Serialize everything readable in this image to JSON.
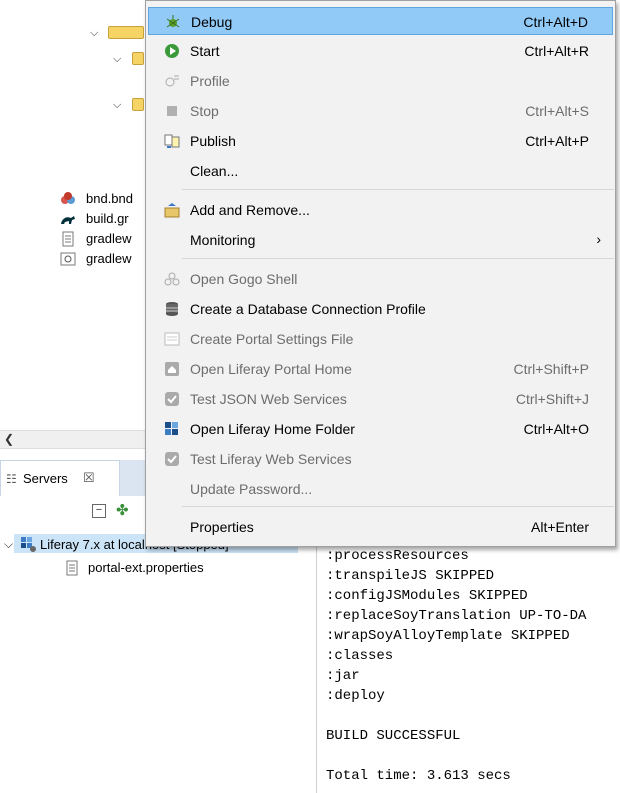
{
  "tree": {
    "files": [
      "bnd.bnd",
      "build.gr",
      "gradlew",
      "gradlew"
    ]
  },
  "servers_view": {
    "tab_label": "Servers",
    "server_name": "Liferay 7.x at localhost [Stopped]",
    "child_file": "portal-ext.properties"
  },
  "context_menu": {
    "items": [
      {
        "label": "Debug",
        "shortcut": "Ctrl+Alt+D"
      },
      {
        "label": "Start",
        "shortcut": "Ctrl+Alt+R"
      },
      {
        "label": "Profile",
        "shortcut": ""
      },
      {
        "label": "Stop",
        "shortcut": "Ctrl+Alt+S"
      },
      {
        "label": "Publish",
        "shortcut": "Ctrl+Alt+P"
      },
      {
        "label": "Clean...",
        "shortcut": ""
      },
      {
        "label": "Add and Remove...",
        "shortcut": ""
      },
      {
        "label": "Monitoring",
        "shortcut": ""
      },
      {
        "label": "Open Gogo Shell",
        "shortcut": ""
      },
      {
        "label": "Create a Database Connection Profile",
        "shortcut": ""
      },
      {
        "label": "Create Portal Settings File",
        "shortcut": ""
      },
      {
        "label": "Open Liferay Portal Home",
        "shortcut": "Ctrl+Shift+P"
      },
      {
        "label": "Test JSON Web Services",
        "shortcut": "Ctrl+Shift+J"
      },
      {
        "label": "Open Liferay Home Folder",
        "shortcut": "Ctrl+Alt+O"
      },
      {
        "label": "Test Liferay Web Services",
        "shortcut": ""
      },
      {
        "label": "Update Password...",
        "shortcut": ""
      },
      {
        "label": "Properties",
        "shortcut": "Alt+Enter"
      }
    ]
  },
  "console": {
    "lines": [
      ":processResources",
      ":transpileJS SKIPPED",
      ":configJSModules SKIPPED",
      ":replaceSoyTranslation UP-TO-DA",
      ":wrapSoyAlloyTemplate SKIPPED",
      ":classes",
      ":jar",
      ":deploy",
      "",
      "BUILD SUCCESSFUL",
      "",
      "Total time: 3.613 secs"
    ]
  },
  "colors": {
    "menu_highlight": "#91c9f7",
    "selection": "#cce4f7"
  }
}
